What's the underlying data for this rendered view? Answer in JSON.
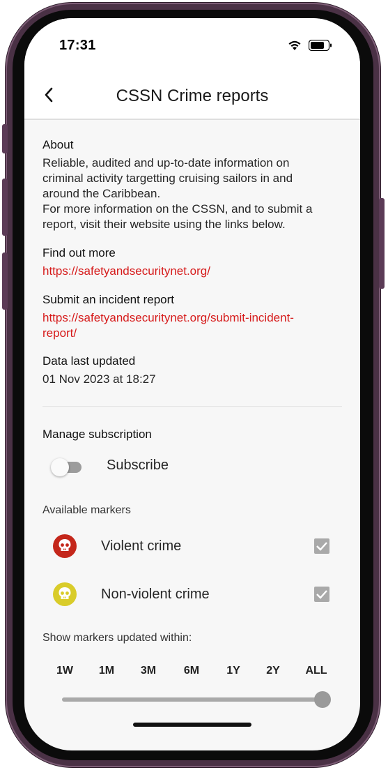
{
  "status": {
    "time": "17:31"
  },
  "header": {
    "title": "CSSN Crime reports"
  },
  "about": {
    "heading": "About",
    "line1": "Reliable, audited and up-to-date information on",
    "line2": "criminal activity targetting cruising sailors in and",
    "line3": "around the Caribbean.",
    "line4": "For more information on the CSSN, and to submit a",
    "line5": "report, visit their website using the links below."
  },
  "find_out_more": {
    "heading": "Find out more",
    "link": "https://safetyandsecuritynet.org/"
  },
  "submit_report": {
    "heading": "Submit an incident report",
    "link_line1": "https://safetyandsecuritynet.org/submit-incident-",
    "link_line2": "report/"
  },
  "data_updated": {
    "heading": "Data last updated",
    "value": "01 Nov 2023 at 18:27"
  },
  "subscription": {
    "heading": "Manage subscription",
    "toggle_label": "Subscribe",
    "enabled": false
  },
  "markers": {
    "heading": "Available markers",
    "items": [
      {
        "label": "Violent crime",
        "checked": true,
        "color": "#c4271b"
      },
      {
        "label": "Non-violent crime",
        "checked": true,
        "color": "#d9cc2a"
      }
    ]
  },
  "range": {
    "heading": "Show markers updated within:",
    "options": [
      "1W",
      "1M",
      "3M",
      "6M",
      "1Y",
      "2Y",
      "ALL"
    ],
    "selected": "ALL"
  }
}
